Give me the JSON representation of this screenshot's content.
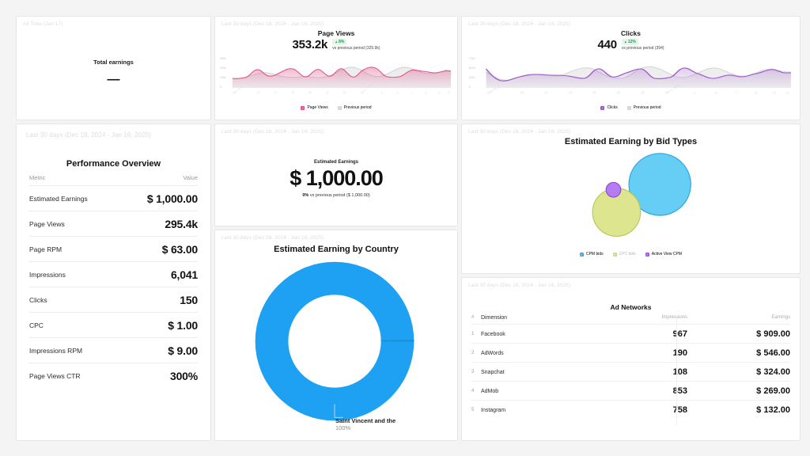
{
  "cards": {
    "total_earnings": {
      "date_range": "All Time (Jan 17)",
      "label": "Total earnings",
      "value": "—"
    },
    "page_views": {
      "date_range": "Last 30 days (Dec 18, 2024 - Jan 16, 2025)",
      "title": "Page Views",
      "value": "353.2k",
      "badge": "8%",
      "comparison": "vs previous period (325.9k)",
      "legend": [
        "Page Views",
        "Previous period"
      ],
      "color": "#e0538a",
      "prev_color": "#d4d4d4"
    },
    "clicks": {
      "date_range": "Last 30 days (Dec 18, 2024 - Jan 16, 2025)",
      "title": "Clicks",
      "value": "440",
      "badge": "12%",
      "comparison": "vs previous period (394)",
      "legend": [
        "Clicks",
        "Previous period"
      ],
      "color": "#9a56c8",
      "prev_color": "#d4d4d4"
    },
    "performance": {
      "date_range": "Last 30 days (Dec 18, 2024 - Jan 16, 2025)",
      "title": "Performance Overview",
      "columns": [
        "Metric",
        "Value"
      ],
      "rows": [
        {
          "metric": "Estimated Earnings",
          "value": "$ 1,000.00"
        },
        {
          "metric": "Page Views",
          "value": "295.4k"
        },
        {
          "metric": "Page RPM",
          "value": "$ 63.00"
        },
        {
          "metric": "Impressions",
          "value": "6,041"
        },
        {
          "metric": "Clicks",
          "value": "150"
        },
        {
          "metric": "CPC",
          "value": "$ 1.00"
        },
        {
          "metric": "Impressions RPM",
          "value": "$ 9.00"
        },
        {
          "metric": "Page Views CTR",
          "value": "300%"
        }
      ]
    },
    "estimated_earnings": {
      "date_range": "Last 30 days (Dec 18, 2024 - Jan 16, 2025)",
      "label": "Estimated Earnings",
      "value": "$ 1,000.00",
      "delta": "0%",
      "comparison": "vs previous period ($ 1,000.00)"
    },
    "country": {
      "date_range": "Last 30 days (Dec 18, 2024 - Jan 16, 2025)",
      "title": "Estimated Earning by Country",
      "callout_label": "Saint Vincent and the ",
      "callout_pct": "100%"
    },
    "bid_types": {
      "date_range": "Last 30 days (Dec 18, 2024 - Jan 16, 2025)",
      "title": "Estimated Earning by Bid Types",
      "legend": [
        "CPM bids",
        "CPC bids",
        "Active View CPM"
      ]
    },
    "ad_networks": {
      "date_range": "Last 30 days (Dec 18, 2024 - Jan 16, 2025)",
      "title": "Ad Networks",
      "columns": [
        "#",
        "Dimension",
        "Impressions",
        "Earnings"
      ],
      "rows": [
        {
          "n": "1",
          "dimension": "Facebook",
          "impressions": "967",
          "earnings": "$ 909.00"
        },
        {
          "n": "2",
          "dimension": "AdWords",
          "impressions": "190",
          "earnings": "$ 546.00"
        },
        {
          "n": "3",
          "dimension": "Snapchat",
          "impressions": "108",
          "earnings": "$ 324.00"
        },
        {
          "n": "4",
          "dimension": "AdMob",
          "impressions": "853",
          "earnings": "$ 269.00"
        },
        {
          "n": "5",
          "dimension": "Instagram",
          "impressions": "758",
          "earnings": "$ 132.00"
        }
      ]
    }
  },
  "chart_data": [
    {
      "type": "area",
      "title": "Page Views",
      "ylabel": "",
      "xlabel": "",
      "ylim": [
        0,
        700000
      ],
      "yticks": [
        "0",
        "200k",
        "400k",
        "600k"
      ],
      "xticks": [
        "Dec 18, 2024",
        "Dec 20",
        "Dec 22",
        "Dec 24",
        "Dec 26",
        "Dec 28",
        "Dec 30",
        "Jan 1, 2025",
        "Jan 3",
        "Jan 5",
        "Jan 7",
        "Jan 9",
        "Jan 11",
        "Jan 13",
        "Jan 15"
      ],
      "legend": [
        "Page Views",
        "Previous period"
      ],
      "legend_position": "bottom",
      "grid": false,
      "series": [
        {
          "name": "Page Views",
          "color": "#e0538a",
          "values": [
            220000,
            215000,
            255000,
            390000,
            300000,
            250000,
            300000,
            400000,
            300000,
            260000,
            400000,
            270000,
            330000,
            420000,
            300000,
            250000,
            420000,
            260000,
            230000,
            280000,
            430000,
            270000,
            250000,
            330000,
            360000,
            350000,
            390000,
            330000,
            360000,
            370000
          ]
        },
        {
          "name": "Previous period",
          "color": "#d9d9d9",
          "values": [
            250000,
            230000,
            260000,
            300000,
            320000,
            290000,
            320000,
            300000,
            260000,
            230000,
            250000,
            260000,
            290000,
            260000,
            230000,
            380000,
            430000,
            300000,
            250000,
            300000,
            420000,
            330000,
            280000,
            400000,
            390000,
            300000,
            320000,
            340000,
            330000,
            350000
          ]
        }
      ]
    },
    {
      "type": "area",
      "title": "Clicks",
      "ylabel": "",
      "xlabel": "",
      "ylim": [
        0,
        820
      ],
      "yticks": [
        "0",
        "250",
        "500",
        "750"
      ],
      "xticks": [
        "Dec 18, 2024",
        "Dec 20",
        "Dec 22",
        "Dec 24",
        "Dec 26",
        "Dec 28",
        "Dec 30",
        "Jan 1, 2025",
        "Jan 3",
        "Jan 5",
        "Jan 7",
        "Jan 9",
        "Jan 11",
        "Jan 13",
        "Jan 15"
      ],
      "legend": [
        "Clicks",
        "Previous period"
      ],
      "legend_position": "bottom",
      "grid": false,
      "series": [
        {
          "name": "Clicks",
          "color": "#9a56c8",
          "values": [
            500,
            230,
            200,
            260,
            330,
            360,
            340,
            320,
            400,
            280,
            250,
            290,
            230,
            520,
            250,
            220,
            230,
            520,
            440,
            260,
            180,
            380,
            300,
            250,
            300,
            230,
            260,
            480,
            400,
            380
          ]
        },
        {
          "name": "Previous period",
          "color": "#d9d9d9",
          "values": [
            380,
            250,
            210,
            230,
            260,
            300,
            330,
            420,
            380,
            260,
            230,
            260,
            340,
            420,
            560,
            520,
            300,
            250,
            230,
            300,
            340,
            460,
            400,
            300,
            280,
            320,
            420,
            380,
            300,
            340
          ]
        }
      ]
    },
    {
      "type": "pie",
      "title": "Estimated Earning by Country",
      "labels": [
        "Saint Vincent and the Grenadines"
      ],
      "values": [
        100
      ],
      "colors": [
        "#1ea1f2"
      ],
      "donut": true,
      "legend_position": "callout"
    },
    {
      "type": "scatter",
      "title": "Estimated Earning by Bid Types",
      "legend": [
        "CPM bids",
        "CPC bids",
        "Active View CPM"
      ],
      "colors": [
        "#66cdf5",
        "#dde68f",
        "#b57cf0"
      ],
      "legend_position": "bottom",
      "bubbles": [
        {
          "name": "CPM bids",
          "cx": 0.62,
          "cy": 0.36,
          "r": 0.2,
          "color": "#66cdf5",
          "stroke": "#2aa8e0"
        },
        {
          "name": "CPC bids",
          "cx": 0.42,
          "cy": 0.62,
          "r": 0.155,
          "color": "#dde68f",
          "stroke": "#b9c75c"
        },
        {
          "name": "Active View CPM",
          "cx": 0.385,
          "cy": 0.4,
          "r": 0.047,
          "color": "#b57cf0",
          "stroke": "#8e4dd4"
        }
      ]
    },
    {
      "type": "table",
      "title": "Ad Networks",
      "columns": [
        "#",
        "Dimension",
        "Impressions",
        "Earnings"
      ],
      "rows": [
        [
          "1",
          "Facebook",
          967,
          909.0
        ],
        [
          "2",
          "AdWords",
          190,
          546.0
        ],
        [
          "3",
          "Snapchat",
          108,
          324.0
        ],
        [
          "4",
          "AdMob",
          853,
          269.0
        ],
        [
          "5",
          "Instagram",
          758,
          132.0
        ]
      ]
    },
    {
      "type": "table",
      "title": "Performance Overview",
      "columns": [
        "Metric",
        "Value"
      ],
      "rows": [
        [
          "Estimated Earnings",
          "$ 1,000.00"
        ],
        [
          "Page Views",
          "295.4k"
        ],
        [
          "Page RPM",
          "$ 63.00"
        ],
        [
          "Impressions",
          "6,041"
        ],
        [
          "Clicks",
          "150"
        ],
        [
          "CPC",
          "$ 1.00"
        ],
        [
          "Impressions RPM",
          "$ 9.00"
        ],
        [
          "Page Views CTR",
          "300%"
        ]
      ]
    }
  ]
}
